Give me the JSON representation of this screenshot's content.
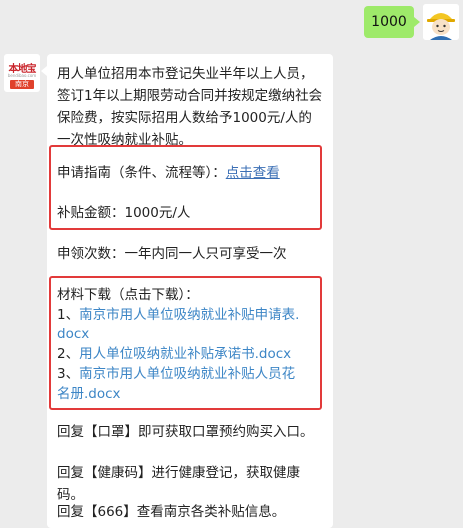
{
  "outgoing": {
    "text": "1000"
  },
  "account": {
    "brand": "本地宝",
    "sub": "bendibao.com",
    "city": "南京"
  },
  "message": {
    "intro": "用人单位招用本市登记失业半年以上人员，签订1年以上期限劳动合同并按规定缴纳社会保险费，按实际招用人数给予1000元/人的一次性吸纳就业补贴。",
    "guide_label": "申请指南（条件、流程等）：",
    "guide_link": "点击查看",
    "amount": "补贴金额：1000元/人",
    "times": "申领次数：一年内同一人只可享受一次",
    "download_title": "材料下载（点击下载）：",
    "downloads": [
      {
        "num": "1、",
        "line1": "南京市用人单位吸纳就业补贴申请表.",
        "line2": "docx"
      },
      {
        "num": "2、",
        "line1": "用人单位吸纳就业补贴承诺书.docx",
        "line2": ""
      },
      {
        "num": "3、",
        "line1": "南京市用人单位吸纳就业补贴人员花",
        "line2": "名册.docx"
      }
    ],
    "reply1": "回复【口罩】即可获取口罩预约购买入口。",
    "reply2": "回复【健康码】进行健康登记，获取健康码。",
    "reply3": "回复【666】查看南京各类补贴信息。"
  },
  "colors": {
    "bubble_out": "#9eea6a",
    "link": "#3b6fb5",
    "highlight": "#e23a3a"
  }
}
